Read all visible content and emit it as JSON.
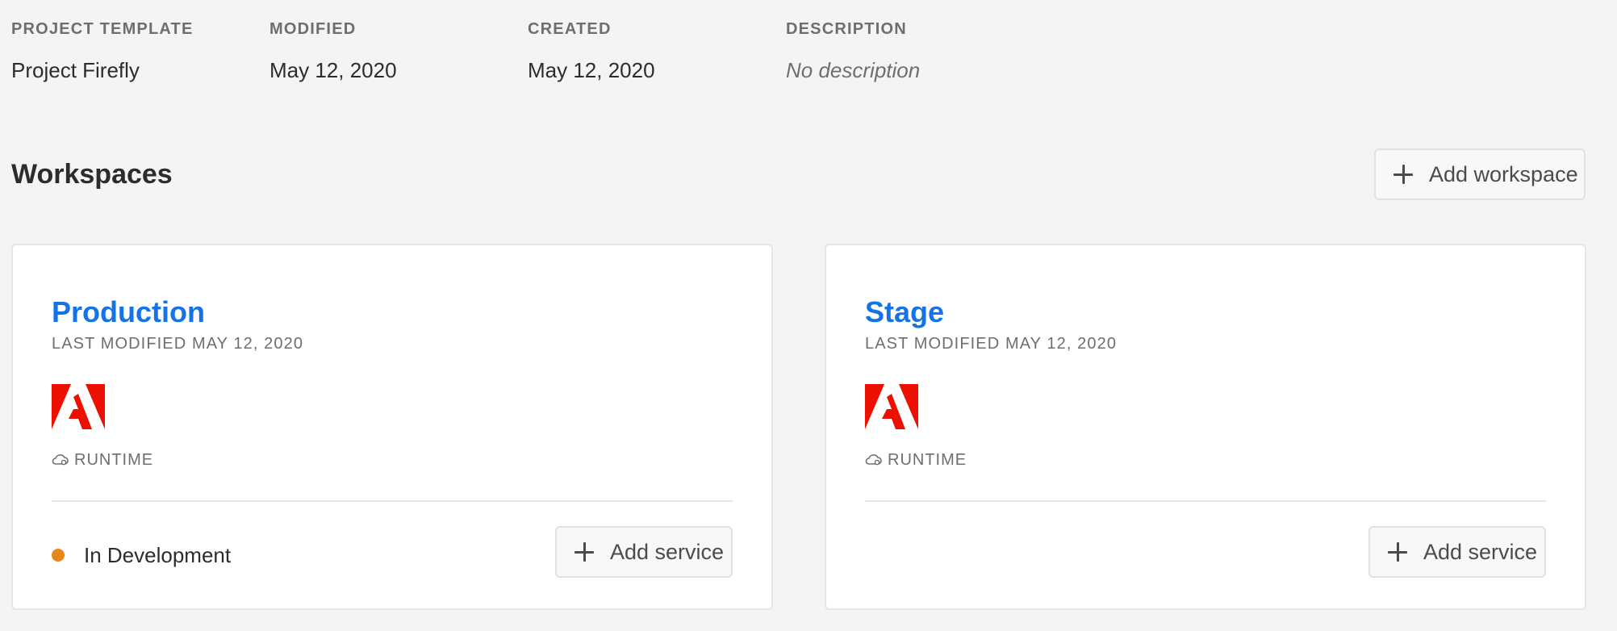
{
  "meta": {
    "project_template": {
      "label": "PROJECT TEMPLATE",
      "value": "Project Firefly"
    },
    "modified": {
      "label": "MODIFIED",
      "value": "May 12, 2020"
    },
    "created": {
      "label": "CREATED",
      "value": "May 12, 2020"
    },
    "description": {
      "label": "DESCRIPTION",
      "value": "No description"
    }
  },
  "workspaces": {
    "title": "Workspaces",
    "add_label": "Add workspace",
    "cards": [
      {
        "title": "Production",
        "last_modified": "LAST MODIFIED MAY 12, 2020",
        "service_label": "RUNTIME",
        "status": "In Development",
        "status_color": "#e68619",
        "add_service_label": "Add service"
      },
      {
        "title": "Stage",
        "last_modified": "LAST MODIFIED MAY 12, 2020",
        "service_label": "RUNTIME",
        "add_service_label": "Add service"
      }
    ]
  },
  "colors": {
    "accent": "#1473e6",
    "adobe_red": "#eb1000",
    "background": "#f4f4f4"
  },
  "icons": [
    "plus-icon",
    "adobe-logo-icon",
    "cloud-runtime-icon",
    "status-dot-icon"
  ]
}
